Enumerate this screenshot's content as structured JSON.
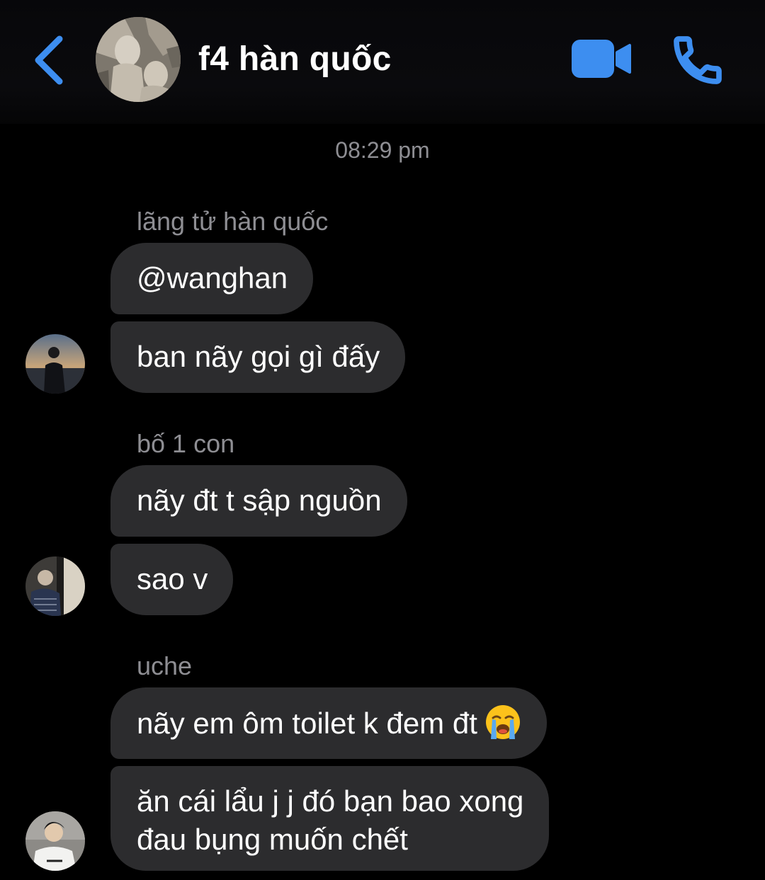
{
  "header": {
    "title": "f4 hàn quốc",
    "back_icon": "chevron-left-icon",
    "video_icon": "video-camera-icon",
    "call_icon": "phone-icon",
    "accent_color": "#3d8ef0"
  },
  "timestamp": "08:29 pm",
  "groups": [
    {
      "sender": "lãng tử hàn quốc",
      "messages": [
        "@wanghan",
        "ban nãy gọi gì đấy"
      ]
    },
    {
      "sender": "bố 1 con",
      "messages": [
        "nãy đt t sập nguồn",
        "sao v"
      ]
    },
    {
      "sender": "uche",
      "messages": [
        "nãy em ôm toilet k đem đt",
        "ăn cái lẩu j j đó bạn bao xong",
        "đau bụng muốn chết"
      ],
      "emoji": "loudly-crying-face-emoji"
    }
  ],
  "colors": {
    "background": "#000000",
    "bubble": "#2c2c2e",
    "secondary_text": "#8e8e93"
  }
}
